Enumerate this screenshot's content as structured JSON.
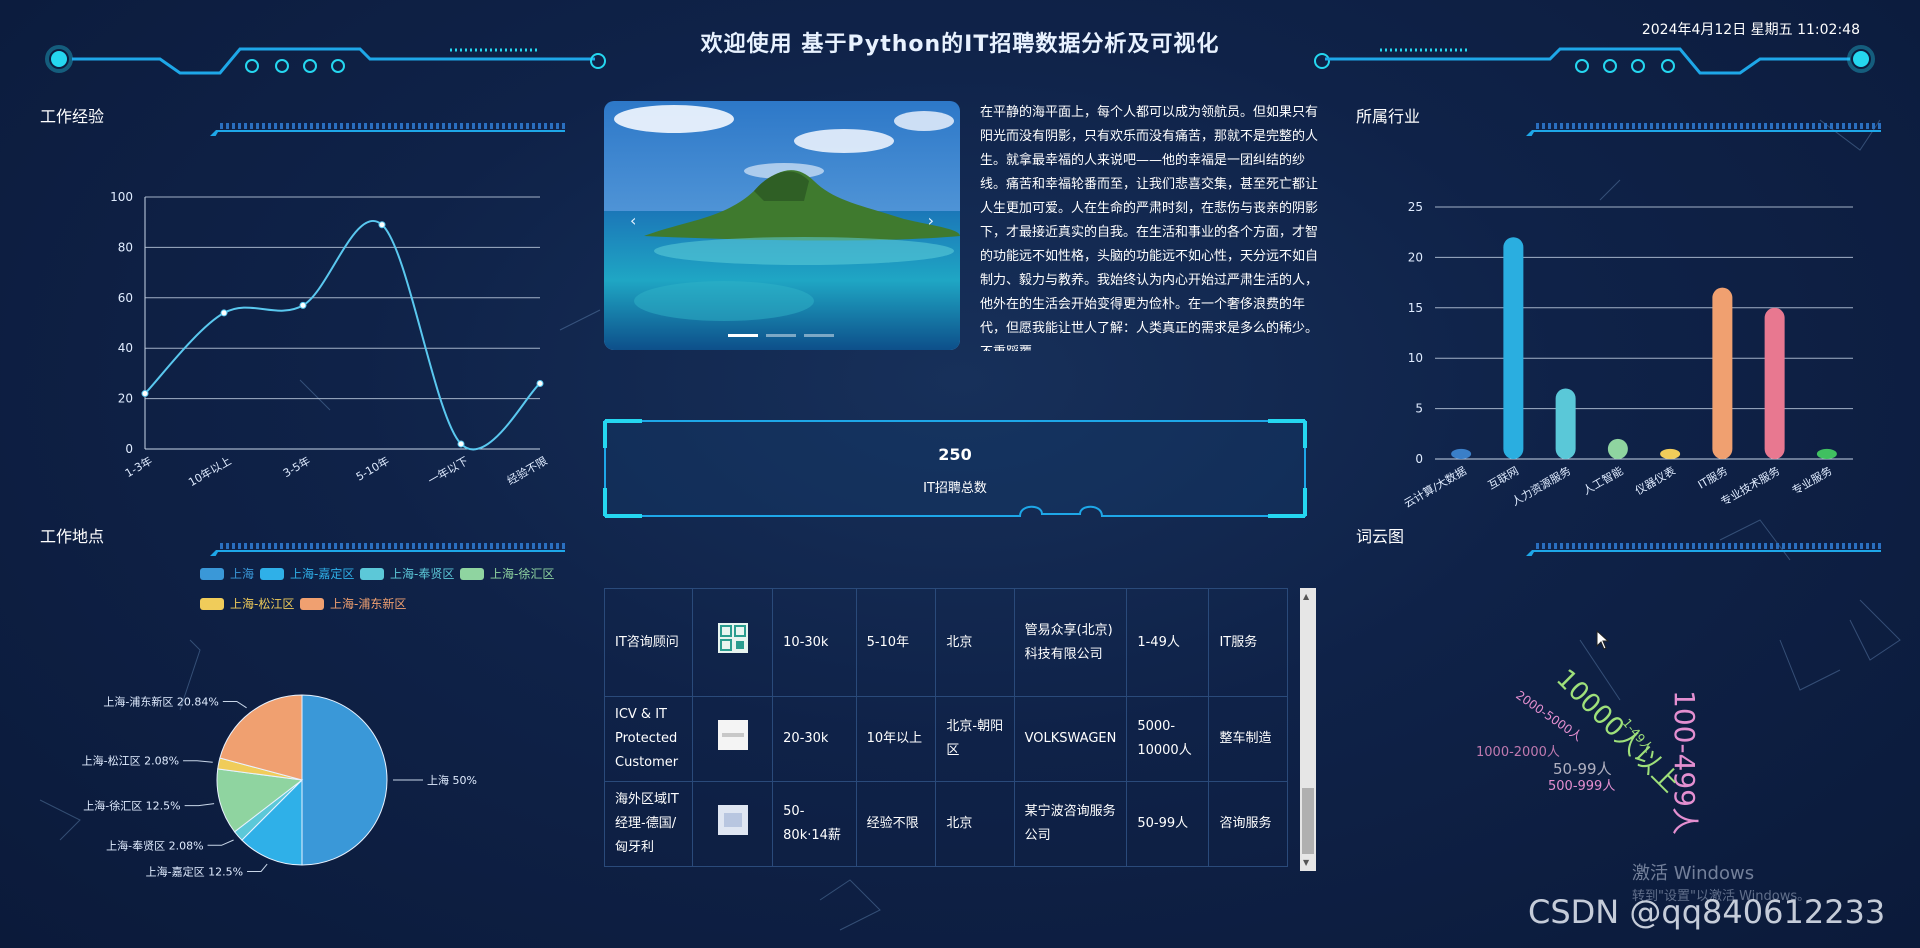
{
  "header": {
    "title": "欢迎使用 基于Python的IT招聘数据分析及可视化",
    "datetime": "2024年4月12日 星期五 11:02:48"
  },
  "colors": {
    "accent": "#1ea7e8",
    "neon": "#25d7f0",
    "panel_line": "#2a4a7a"
  },
  "sections": {
    "experience": "工作经验",
    "location": "工作地点",
    "industry": "所属行业",
    "wordcloud": "词云图"
  },
  "intro": {
    "text": "在平静的海平面上，每个人都可以成为领航员。但如果只有阳光而没有阴影，只有欢乐而没有痛苦，那就不是完整的人生。就拿最幸福的人来说吧——他的幸福是一团纠结的纱线。痛苦和幸福轮番而至，让我们悲喜交集，甚至死亡都让人生更加可爱。人在生命的严肃时刻，在悲伤与丧亲的阴影下，才最接近真实的自我。在生活和事业的各个方面，才智的功能远不如性格，头脑的功能远不如心性，天分远不如自制力、毅力与教养。我始终认为内心开始过严肃生活的人，他外在的生活会开始变得更为俭朴。在一个奢侈浪费的年代，但愿我能让世人了解：人类真正的需求是多么的稀少。不重蹈覆"
  },
  "carousel": {
    "prev_icon": "‹",
    "next_icon": "›"
  },
  "total": {
    "value": "250",
    "label": "IT招聘总数"
  },
  "jobs": [
    {
      "title": "IT咨询顾问",
      "salary": "10-30k",
      "experience": "5-10年",
      "city": "北京",
      "company": "管易众享(北京)科技有限公司",
      "size": "1-49人",
      "industry": "IT服务",
      "logo": "qr-logo"
    },
    {
      "title": "ICV & IT Protected Customer",
      "salary": "20-30k",
      "experience": "10年以上",
      "city": "北京-朝阳区",
      "company": "VOLKSWAGEN",
      "size": "5000-10000人",
      "industry": "整车制造",
      "logo": "brand-logo"
    },
    {
      "title": "海外区域IT经理-德国/匈牙利",
      "salary": "50-80k·14薪",
      "experience": "经验不限",
      "city": "北京",
      "company": "某宁波咨询服务公司",
      "size": "50-99人",
      "industry": "咨询服务",
      "logo": "placeholder-logo"
    }
  ],
  "wordcloud": {
    "words": [
      {
        "text": "100-499人",
        "color": "#e48fd0"
      },
      {
        "text": "10000人以上",
        "color": "#9ee07a"
      },
      {
        "text": "2000-5000人",
        "color": "#e48fd0"
      },
      {
        "text": "1-49人",
        "color": "#9ee07a"
      },
      {
        "text": "1000-2000人",
        "color": "#c07ab0"
      },
      {
        "text": "50-99人",
        "color": "#b0b0c0"
      },
      {
        "text": "500-999人",
        "color": "#e48fd0"
      }
    ]
  },
  "watermark": {
    "line1": "激活 Windows",
    "line2": "转到\"设置\"以激活 Windows。",
    "csdn": "CSDN @qq840612233"
  },
  "chart_data": [
    {
      "type": "line",
      "x": [
        "1-3年",
        "10年以上",
        "3-5年",
        "5-10年",
        "一年以下",
        "经验不限"
      ],
      "values": [
        22,
        54,
        57,
        89,
        2,
        26
      ],
      "ylim": [
        0,
        100
      ],
      "yticks": [
        0,
        20,
        40,
        60,
        80,
        100
      ],
      "xlabel": "",
      "ylabel": "",
      "grid": true,
      "color": "#5ac8ef"
    },
    {
      "type": "pie",
      "legend": "top",
      "slices": [
        {
          "name": "上海",
          "value": 50,
          "label": "上海 50%",
          "color": "#3a98d8"
        },
        {
          "name": "上海-嘉定区",
          "value": 12.5,
          "label": "上海-嘉定区 12.5%",
          "color": "#2fb0e8"
        },
        {
          "name": "上海-奉贤区",
          "value": 2.08,
          "label": "上海-奉贤区 2.08%",
          "color": "#5cc8d8"
        },
        {
          "name": "上海-徐汇区",
          "value": 12.5,
          "label": "上海-徐汇区 12.5%",
          "color": "#8fd4a0"
        },
        {
          "name": "上海-松江区",
          "value": 2.08,
          "label": "上海-松江区 2.08%",
          "color": "#f0cc5a"
        },
        {
          "name": "上海-浦东新区",
          "value": 20.84,
          "label": "上海-浦东新区 20.84%",
          "color": "#f0a070"
        }
      ]
    },
    {
      "type": "bar",
      "categories": [
        "云计算/大数据",
        "互联网",
        "人力资源服务",
        "人工智能",
        "仪器仪表",
        "IT服务",
        "专业技术服务",
        "专业服务"
      ],
      "values": [
        1,
        22,
        7,
        2,
        1,
        17,
        15,
        1
      ],
      "colors": [
        "#3a7fc8",
        "#2aaee0",
        "#5ac8d8",
        "#8fd4a0",
        "#f0cc5a",
        "#f0a070",
        "#e87890",
        "#40c060"
      ],
      "ylim": [
        0,
        25
      ],
      "yticks": [
        0,
        5,
        10,
        15,
        20,
        25
      ],
      "grid": true
    }
  ]
}
